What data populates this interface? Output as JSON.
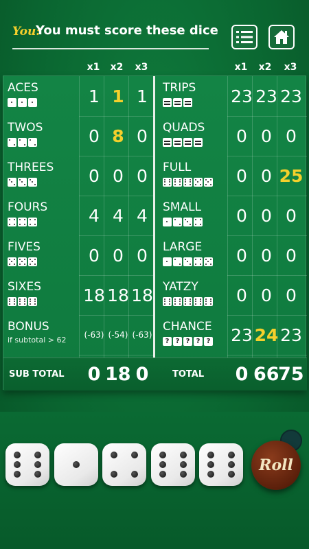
{
  "header": {
    "player_label": "You:",
    "message": "You must score these dice",
    "menu_icon": "list-icon",
    "home_icon": "home-icon"
  },
  "column_headers": {
    "left": [
      "x1",
      "x2",
      "x3"
    ],
    "right": [
      "x1",
      "x2",
      "x3"
    ]
  },
  "left_categories": [
    {
      "name": "ACES",
      "dice": [
        1,
        1,
        1
      ],
      "scores": [
        "1",
        "1",
        "1"
      ],
      "highlight": [
        false,
        true,
        false
      ]
    },
    {
      "name": "TWOS",
      "dice": [
        2,
        2,
        2
      ],
      "scores": [
        "0",
        "8",
        "0"
      ],
      "highlight": [
        false,
        true,
        false
      ]
    },
    {
      "name": "THREES",
      "dice": [
        3,
        3,
        3
      ],
      "scores": [
        "0",
        "0",
        "0"
      ],
      "highlight": [
        false,
        false,
        false
      ]
    },
    {
      "name": "FOURS",
      "dice": [
        4,
        4,
        4
      ],
      "scores": [
        "4",
        "4",
        "4"
      ],
      "highlight": [
        false,
        false,
        false
      ]
    },
    {
      "name": "FIVES",
      "dice": [
        5,
        5,
        5
      ],
      "scores": [
        "0",
        "0",
        "0"
      ],
      "highlight": [
        false,
        false,
        false
      ]
    },
    {
      "name": "SIXES",
      "dice": [
        6,
        6,
        6
      ],
      "scores": [
        "18",
        "18",
        "18"
      ],
      "highlight": [
        false,
        false,
        false
      ]
    },
    {
      "name": "BONUS",
      "subtitle": "if subtotal > 62",
      "dice": [],
      "scores": [
        "(-63)",
        "(-54)",
        "(-63)"
      ],
      "highlight": [
        false,
        false,
        false
      ]
    }
  ],
  "right_categories": [
    {
      "name": "TRIPS",
      "dice": [
        "=",
        "=",
        "="
      ],
      "scores": [
        "23",
        "23",
        "23"
      ],
      "highlight": [
        false,
        false,
        false
      ]
    },
    {
      "name": "QUADS",
      "dice": [
        "=",
        "=",
        "=",
        "="
      ],
      "scores": [
        "0",
        "0",
        "0"
      ],
      "highlight": [
        false,
        false,
        false
      ]
    },
    {
      "name": "FULL",
      "dice": [
        6,
        6,
        6,
        5,
        5
      ],
      "scores": [
        "0",
        "0",
        "25"
      ],
      "highlight": [
        false,
        false,
        true
      ]
    },
    {
      "name": "SMALL",
      "dice": [
        1,
        2,
        3,
        4
      ],
      "scores": [
        "0",
        "0",
        "0"
      ],
      "highlight": [
        false,
        false,
        false
      ]
    },
    {
      "name": "LARGE",
      "dice": [
        1,
        2,
        3,
        4,
        5
      ],
      "scores": [
        "0",
        "0",
        "0"
      ],
      "highlight": [
        false,
        false,
        false
      ]
    },
    {
      "name": "YATZY",
      "dice": [
        6,
        6,
        6,
        6,
        6
      ],
      "scores": [
        "0",
        "0",
        "0"
      ],
      "highlight": [
        false,
        false,
        false
      ]
    },
    {
      "name": "CHANCE",
      "dice": [
        "?",
        "?",
        "?",
        "?",
        "?"
      ],
      "scores": [
        "23",
        "24",
        "23"
      ],
      "highlight": [
        false,
        true,
        false
      ]
    }
  ],
  "totals": {
    "subtotal_label": "SUB TOTAL",
    "subtotal_values": [
      "0",
      "18",
      "0"
    ],
    "total_label": "TOTAL",
    "total_values": [
      "0",
      "66",
      "75"
    ]
  },
  "dice_tray": [
    6,
    1,
    4,
    6,
    6
  ],
  "roll_button": {
    "label": "Roll"
  },
  "colors": {
    "highlight": "#f5d02c",
    "felt": "#0f7a3e",
    "roll": "#6b2710"
  }
}
